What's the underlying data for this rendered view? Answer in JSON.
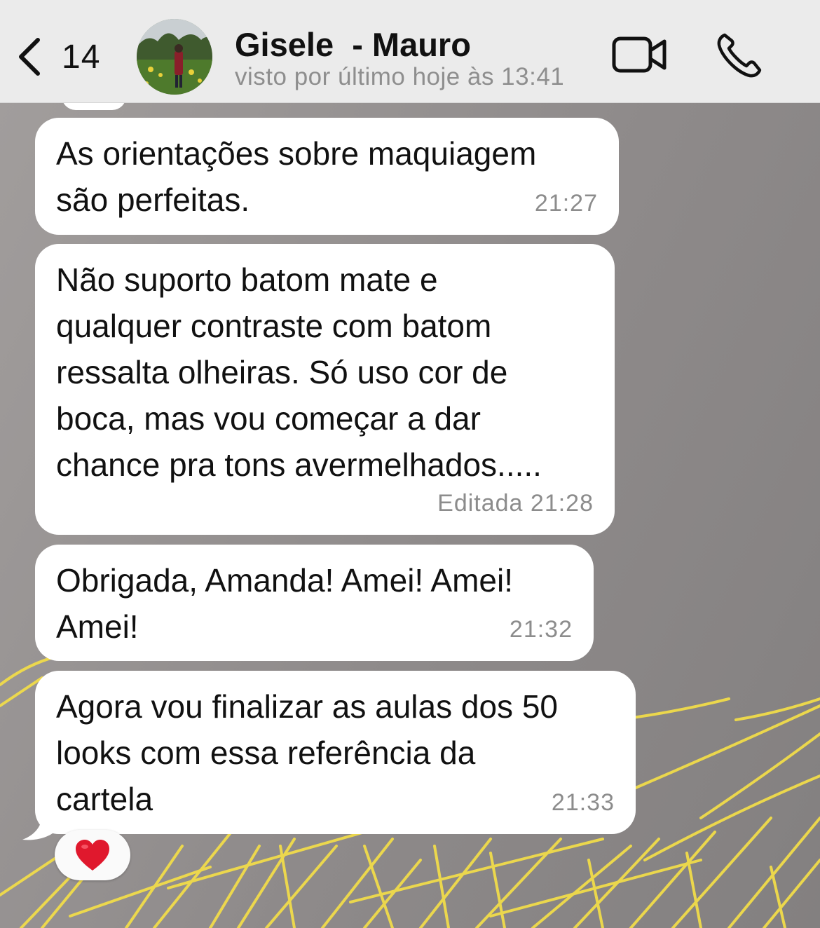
{
  "header": {
    "back_count": "14",
    "contact_name": "Gisele  - Mauro",
    "last_seen": "visto por último hoje às 13:41",
    "icons": {
      "back": "chevron-left-icon",
      "video": "video-camera-icon",
      "call": "phone-icon"
    }
  },
  "messages": [
    {
      "text": "As orientações sobre maquiagem\nsão perfeitas.",
      "time": "21:27"
    },
    {
      "text": "Não suporto batom mate e\nqualquer contraste com batom\nressalta olheiras. Só uso cor de\nboca, mas vou começar a dar\nchance pra tons avermelhados.....",
      "time": "Editada 21:28"
    },
    {
      "text": "Obrigada, Amanda! Amei! Amei!\nAmei!",
      "time": "21:32"
    },
    {
      "text": "Agora vou finalizar as aulas dos 50\nlooks com essa referência da\ncartela",
      "time": "21:33"
    }
  ],
  "reaction": {
    "emoji": "❤️",
    "icon": "heart-icon"
  },
  "colors": {
    "header_bg": "#ebebeb",
    "chat_bg": "#8f8b8b",
    "bubble_bg": "#ffffff",
    "meta_text": "#8c8c8c",
    "wallpaper_lines": "#f1dc4a",
    "heart": "#e0182d"
  }
}
